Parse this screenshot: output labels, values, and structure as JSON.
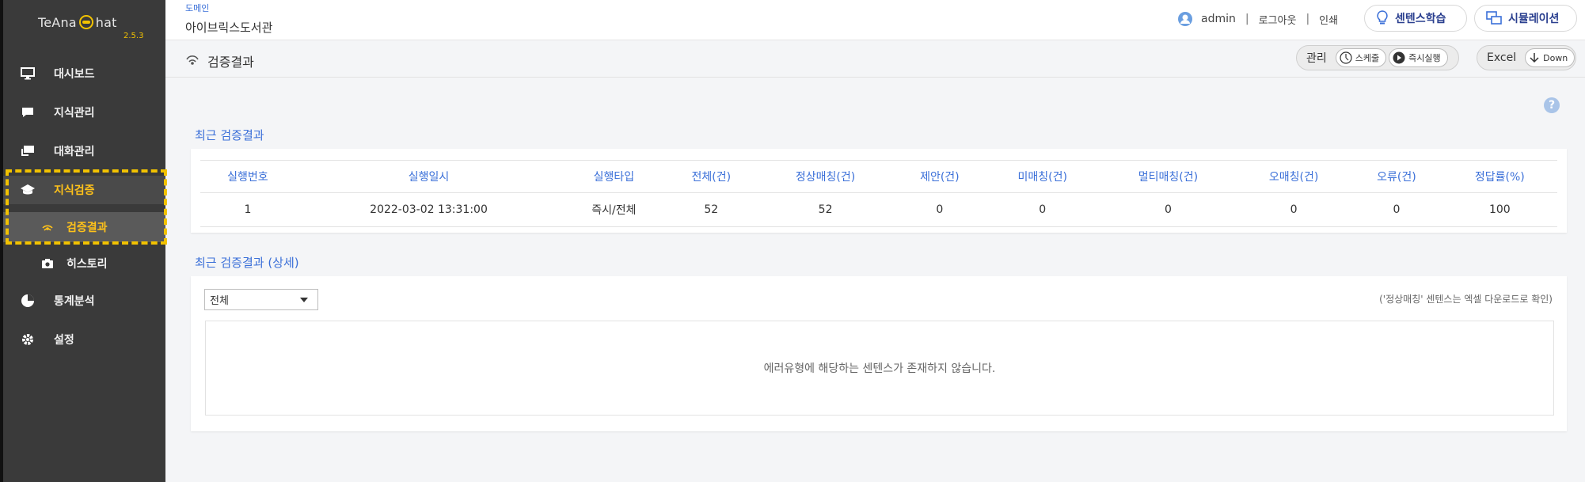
{
  "brand": {
    "name": "TeAna",
    "name2": "hat",
    "version": "2.5.3",
    "highlight_color": "#f2c200"
  },
  "sidebar": {
    "items": [
      {
        "label": "대시보드",
        "icon": "monitor-icon"
      },
      {
        "label": "지식관리",
        "icon": "chat-bubble-icon"
      },
      {
        "label": "대화관리",
        "icon": "conversation-icon"
      },
      {
        "label": "지식검증",
        "icon": "graduation-cap-icon",
        "active": true
      },
      {
        "label": "검증결과",
        "icon": "signal-icon",
        "active": true,
        "sub": true
      },
      {
        "label": "히스토리",
        "icon": "camera-icon",
        "sub": true
      },
      {
        "label": "통계분석",
        "icon": "pie-chart-icon"
      },
      {
        "label": "설정",
        "icon": "gear-icon"
      }
    ]
  },
  "header": {
    "domain_label": "도메인",
    "domain_value": "아이브릭스도서관",
    "user": "admin",
    "logout": "로그아웃",
    "print": "인쇄",
    "sentence_learning": "센텐스학습",
    "simulation": "시뮬레이션"
  },
  "subbar": {
    "page_title": "검증결과",
    "manage_label": "관리",
    "schedule": "스케줄",
    "run_now": "즉시실행",
    "excel_label": "Excel",
    "down": "Down"
  },
  "summary": {
    "title": "최근 검증결과",
    "headers": [
      "실행번호",
      "실행일시",
      "실행타입",
      "전체(건)",
      "정상매칭(건)",
      "제안(건)",
      "미매칭(건)",
      "멀티매칭(건)",
      "오매칭(건)",
      "오류(건)",
      "정답률(%)"
    ],
    "row": [
      "1",
      "2022-03-02 13:31:00",
      "즉시/전체",
      "52",
      "52",
      "0",
      "0",
      "0",
      "0",
      "0",
      "100"
    ]
  },
  "detail": {
    "title": "최근 검증결과 (상세)",
    "filter_value": "전체",
    "note": "('정상매칭' 센텐스는 엑셀 다운로드로 확인)",
    "empty_message": "에러유형에 해당하는 센텐스가 존재하지 않습니다."
  }
}
